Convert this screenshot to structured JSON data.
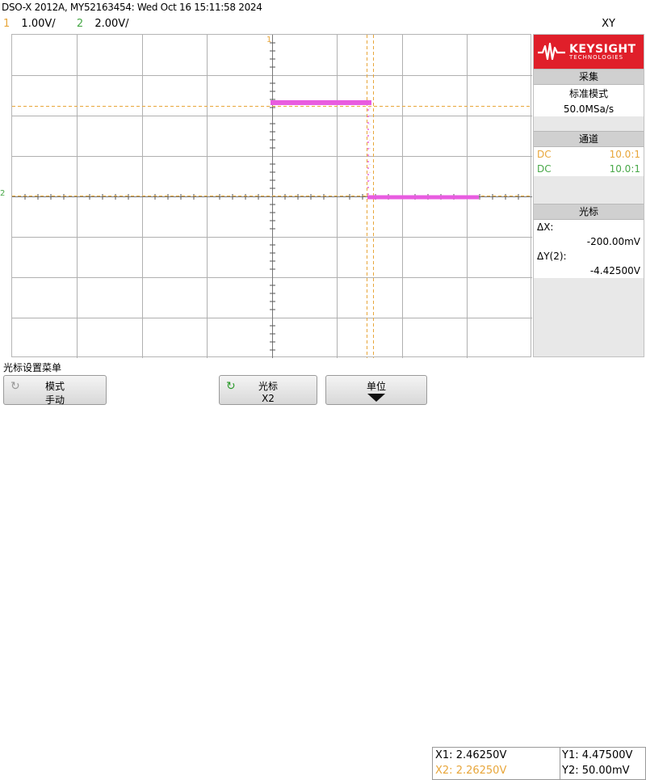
{
  "header": {
    "title": "DSO-X 2012A, MY52163454: Wed Oct 16 15:11:58 2024",
    "ch1_num": "1",
    "ch1_scale": "1.00V/",
    "ch2_num": "2",
    "ch2_scale": "2.00V/",
    "mode": "XY"
  },
  "markers": {
    "ch1": "1",
    "ch2": "2"
  },
  "colors": {
    "ch1": "#e8a63a",
    "ch2": "#48a848",
    "trace": "#e85ce0",
    "brand": "#e01f2a"
  },
  "panel": {
    "brand_name": "KEYSIGHT",
    "brand_sub": "TECHNOLOGIES",
    "acq_title": "采集",
    "acq_mode": "标准模式",
    "acq_rate": "50.0MSa/s",
    "ch_title": "通道",
    "ch1_coupling": "DC",
    "ch1_probe": "10.0:1",
    "ch2_coupling": "DC",
    "ch2_probe": "10.0:1",
    "cursor_title": "光标",
    "dx_label": "ΔX:",
    "dx_value": "-200.00mV",
    "dy_label": "ΔY(2):",
    "dy_value": "-4.42500V"
  },
  "footer": {
    "menu_label": "光标设置菜单",
    "mode_l1": "模式",
    "mode_l2": "手动",
    "cursor_l1": "光标",
    "cursor_l2": "X2",
    "unit_l1": "单位",
    "x1": "X1: 2.46250V",
    "x2": "X2: 2.26250V",
    "y1": "Y1: 4.47500V",
    "y2": "Y2: 50.00mV"
  }
}
